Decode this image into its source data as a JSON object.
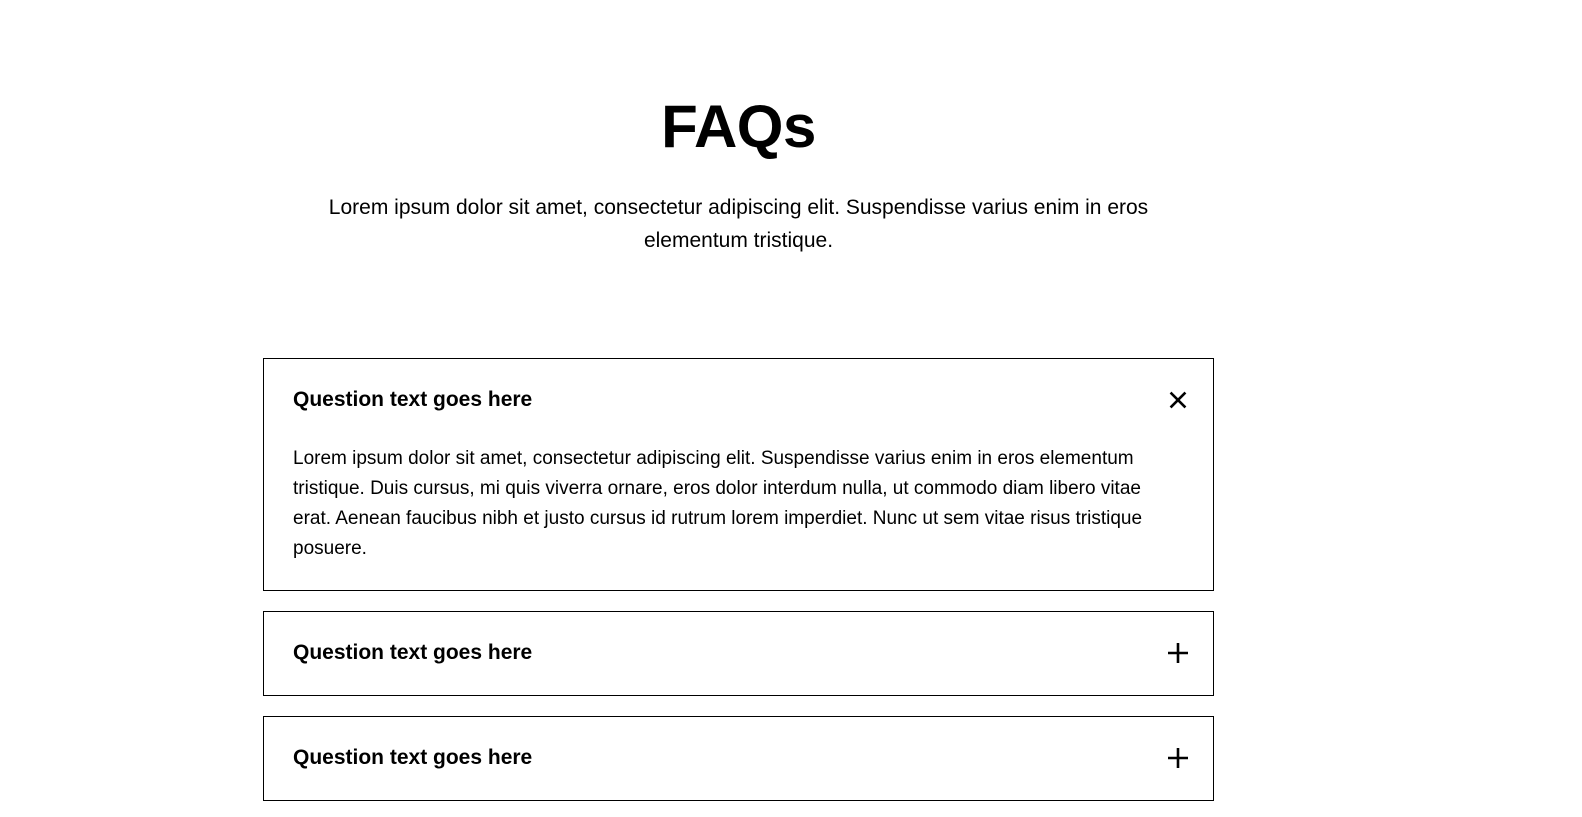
{
  "header": {
    "title": "FAQs",
    "intro": "Lorem ipsum dolor sit amet, consectetur adipiscing elit. Suspendisse varius enim in eros elementum tristique."
  },
  "faqs": [
    {
      "question": "Question text goes here",
      "answer": "Lorem ipsum dolor sit amet, consectetur adipiscing elit. Suspendisse varius enim in eros elementum tristique. Duis cursus, mi quis viverra ornare, eros dolor interdum nulla, ut commodo diam libero vitae erat. Aenean faucibus nibh et justo cursus id rutrum lorem imperdiet. Nunc ut sem vitae risus tristique posuere.",
      "expanded": true,
      "icon": "close-icon"
    },
    {
      "question": "Question text goes here",
      "expanded": false,
      "icon": "plus-icon"
    },
    {
      "question": "Question text goes here",
      "expanded": false,
      "icon": "plus-icon"
    }
  ]
}
